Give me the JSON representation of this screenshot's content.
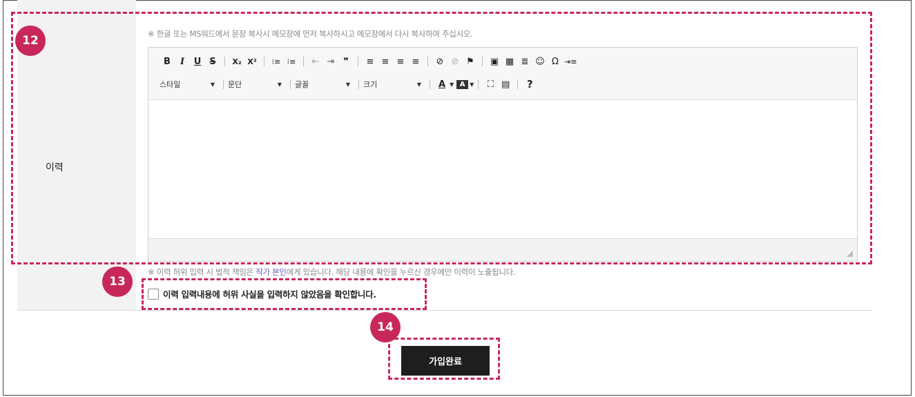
{
  "form": {
    "field_label": "이력",
    "top_notice": "※ 한글 또는 MS워드에서 문장 복사시 메모장에 먼저 복사하시고 메모장에서 다시 복사하여 주십시오.",
    "bottom_notice": {
      "prefix": "※ 이력 허위 입력 시 법적 책임은 ",
      "highlight": "작가 본인",
      "suffix": "에게 있습니다. 해당 내용에 확인을 누르신 경우에만 이력이 노출됩니다."
    },
    "confirm_checkbox_label": "이력 입력내용에 허위 사실을 입력하지 않았음을 확인합니다.",
    "submit_label": "가입완료"
  },
  "editor": {
    "toolbar_row1": [
      "B",
      "I",
      "U",
      "S",
      "X₂",
      "X²",
      "⁝≡",
      "⁝≡",
      "⇤",
      "⇥",
      "❞",
      "≡",
      "≡",
      "≡",
      "≡",
      "⊘",
      "⊘",
      "⚑",
      "▣",
      "▦",
      "≣",
      "☺",
      "Ω",
      "⇥≡"
    ],
    "toolbar_row2_combos": [
      "스타일",
      "문단",
      "글꼴",
      "크기"
    ],
    "toolbar_row2_buttons": [
      "A",
      "A",
      "⛶",
      "▤",
      "?"
    ]
  },
  "annotations": [
    "12",
    "13",
    "14"
  ],
  "colors": {
    "annotation": "#c8275a",
    "submit_bg": "#1e1e1e",
    "label_bg": "#f2f2f2"
  }
}
